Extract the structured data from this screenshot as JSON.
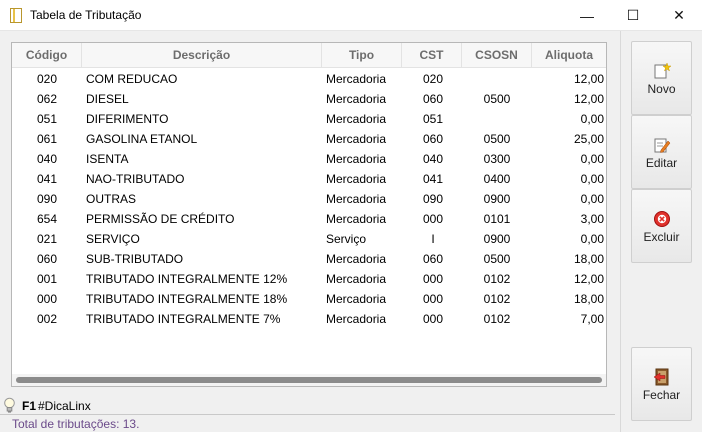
{
  "window": {
    "title": "Tabela de Tributação",
    "minimize_glyph": "—",
    "maximize_glyph": "☐",
    "close_glyph": "✕",
    "app_icon": "document-icon"
  },
  "grid": {
    "columns": {
      "codigo": "Código",
      "descricao": "Descrição",
      "tipo": "Tipo",
      "cst": "CST",
      "csosn": "CSOSN",
      "aliquota": "Aliquota"
    },
    "rows": [
      {
        "codigo": "020",
        "descricao": "COM REDUCAO",
        "tipo": "Mercadoria",
        "cst": "020",
        "csosn": "",
        "aliquota": "12,00"
      },
      {
        "codigo": "062",
        "descricao": "DIESEL",
        "tipo": "Mercadoria",
        "cst": "060",
        "csosn": "0500",
        "aliquota": "12,00"
      },
      {
        "codigo": "051",
        "descricao": "DIFERIMENTO",
        "tipo": "Mercadoria",
        "cst": "051",
        "csosn": "",
        "aliquota": "0,00"
      },
      {
        "codigo": "061",
        "descricao": "GASOLINA ETANOL",
        "tipo": "Mercadoria",
        "cst": "060",
        "csosn": "0500",
        "aliquota": "25,00"
      },
      {
        "codigo": "040",
        "descricao": "ISENTA",
        "tipo": "Mercadoria",
        "cst": "040",
        "csosn": "0300",
        "aliquota": "0,00"
      },
      {
        "codigo": "041",
        "descricao": "NAO-TRIBUTADO",
        "tipo": "Mercadoria",
        "cst": "041",
        "csosn": "0400",
        "aliquota": "0,00"
      },
      {
        "codigo": "090",
        "descricao": "OUTRAS",
        "tipo": "Mercadoria",
        "cst": "090",
        "csosn": "0900",
        "aliquota": "0,00"
      },
      {
        "codigo": "654",
        "descricao": "PERMISSÃO DE CRÉDITO",
        "tipo": "Mercadoria",
        "cst": "000",
        "csosn": "0101",
        "aliquota": "3,00"
      },
      {
        "codigo": "021",
        "descricao": "SERVIÇO",
        "tipo": "Serviço",
        "cst": "I",
        "csosn": "0900",
        "aliquota": "0,00"
      },
      {
        "codigo": "060",
        "descricao": "SUB-TRIBUTADO",
        "tipo": "Mercadoria",
        "cst": "060",
        "csosn": "0500",
        "aliquota": "18,00"
      },
      {
        "codigo": "001",
        "descricao": "TRIBUTADO INTEGRALMENTE 12%",
        "tipo": "Mercadoria",
        "cst": "000",
        "csosn": "0102",
        "aliquota": "12,00"
      },
      {
        "codigo": "000",
        "descricao": "TRIBUTADO INTEGRALMENTE 18%",
        "tipo": "Mercadoria",
        "cst": "000",
        "csosn": "0102",
        "aliquota": "18,00"
      },
      {
        "codigo": "002",
        "descricao": "TRIBUTADO INTEGRALMENTE 7%",
        "tipo": "Mercadoria",
        "cst": "000",
        "csosn": "0102",
        "aliquota": "7,00"
      }
    ]
  },
  "actions": {
    "novo": "Novo",
    "editar": "Editar",
    "excluir": "Excluir",
    "fechar": "Fechar"
  },
  "tip": {
    "key": "F1",
    "text": "#DicaLinx"
  },
  "status": {
    "text": "Total de tributações: 13."
  },
  "colors": {
    "status_text": "#6b4a8a",
    "header_text": "#6d6d6d",
    "scroll_thumb": "#8b8b8b"
  }
}
